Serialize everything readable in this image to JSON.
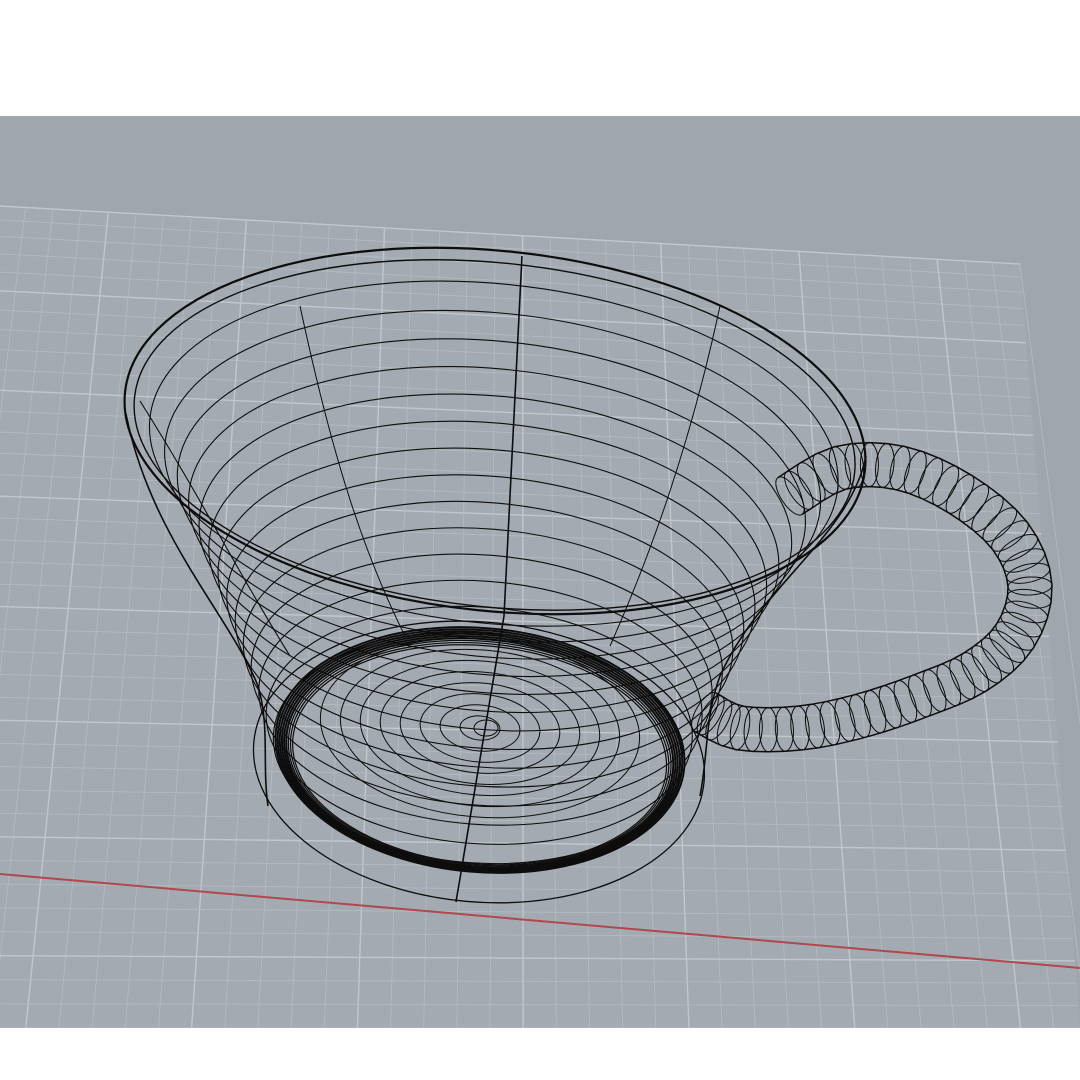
{
  "viewport": {
    "background_color": "#9fa6ad",
    "grid_minor_color": "#b3bac0",
    "grid_major_color": "#c2c7cc",
    "x_axis_color": "#b0484c",
    "wireframe_color": "#0d0d0d"
  },
  "model": {
    "object": "cup",
    "display_mode": "wireframe",
    "parts": [
      "bowl",
      "foot-ring",
      "handle"
    ]
  }
}
